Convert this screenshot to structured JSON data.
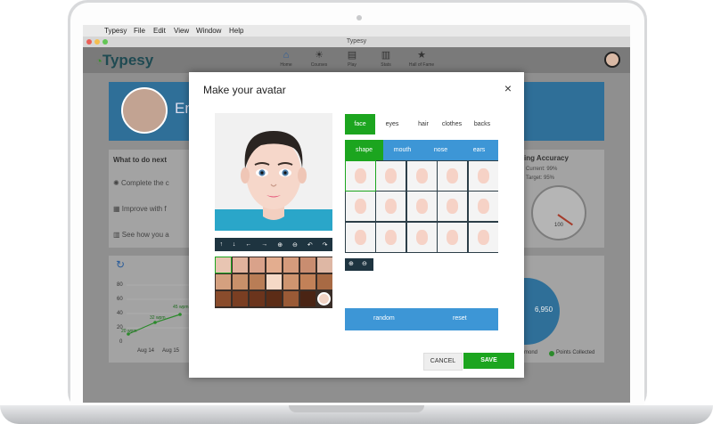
{
  "menubar": {
    "apple_icon": "apple-icon",
    "items": [
      "Typesy",
      "File",
      "Edit",
      "View",
      "Window",
      "Help"
    ]
  },
  "window": {
    "title": "Typesy"
  },
  "app": {
    "logo": "Typesy",
    "nav": [
      {
        "label": "Home",
        "icon": "home-icon"
      },
      {
        "label": "Courses",
        "icon": "lightbulb-icon"
      },
      {
        "label": "Play",
        "icon": "play-icon"
      },
      {
        "label": "Stats",
        "icon": "stats-icon"
      },
      {
        "label": "Hall of Fame",
        "icon": "star-icon"
      }
    ]
  },
  "background": {
    "banner_text": "Em",
    "what_next_title": "What to do next",
    "what_next_items": [
      "Complete the c",
      "Improve with f",
      "See how you a"
    ],
    "accuracy_title": "ing Accuracy",
    "accuracy_current": "Current: 99%",
    "accuracy_target": "Target: 95%",
    "gauge_value": "100",
    "chart_y_ticks": [
      "80",
      "60",
      "40",
      "20",
      "0"
    ],
    "chart_x_ticks": [
      "Aug 14",
      "Aug 15"
    ],
    "chart_labels": [
      "20 wpm",
      "32 wpm",
      "45 wpm"
    ],
    "donut_value": "6,950",
    "legend_left": "mond",
    "legend_right": "Points Collected"
  },
  "modal": {
    "title": "Make your avatar",
    "close": "×",
    "toolbar": [
      "↑",
      "↓",
      "←",
      "→",
      "⊕",
      "⊖",
      "↶",
      "↷"
    ],
    "tabs": [
      "face",
      "eyes",
      "hair",
      "clothes",
      "backs"
    ],
    "subtabs": [
      "shape",
      "mouth",
      "nose",
      "ears"
    ],
    "zoom": [
      "⊕",
      "⊖"
    ],
    "random": "random",
    "reset": "reset",
    "cancel": "CANCEL",
    "save": "SAVE"
  },
  "colors": {
    "accent": "#3d96d6",
    "save": "#1ca51f",
    "active_tab": "#1ca51f",
    "skin_swatches": [
      "#e8c5b2",
      "#e1b39d",
      "#d9a28a",
      "#e3ad8f",
      "#d59b7c",
      "#c98d70",
      "#deb7a4",
      "#d4a07f",
      "#c8906a",
      "#b97d56",
      "#f5d9c6",
      "#cf9570",
      "#c28158",
      "#a86a44",
      "#8a4c2c",
      "#7a3e22",
      "#6b341c",
      "#5c2c16",
      "#9a5a36",
      "#4a2414"
    ]
  }
}
